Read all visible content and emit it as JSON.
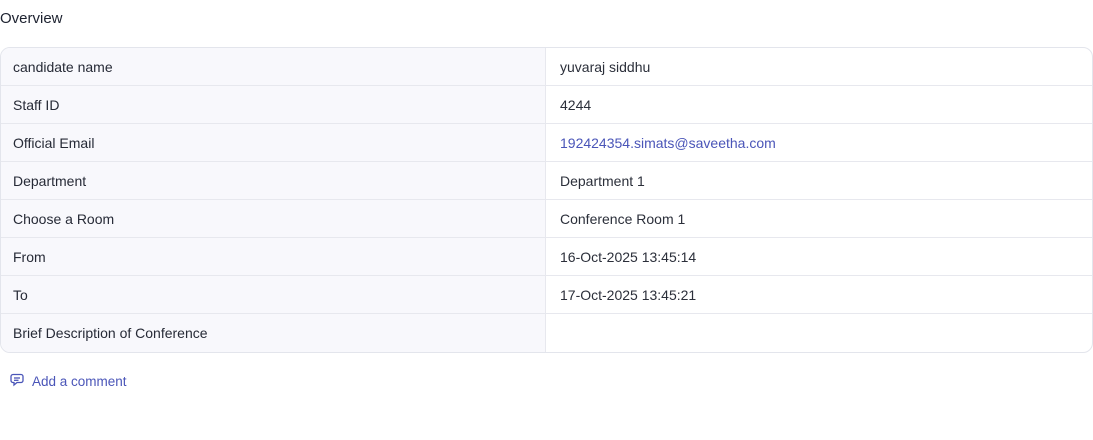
{
  "overview": {
    "title": "Overview",
    "rows": [
      {
        "label": "candidate name",
        "value": "yuvaraj siddhu"
      },
      {
        "label": "Staff ID",
        "value": "4244"
      },
      {
        "label": "Official Email",
        "value": "192424354.simats@saveetha.com"
      },
      {
        "label": "Department",
        "value": "Department 1"
      },
      {
        "label": "Choose a Room",
        "value": "Conference Room 1"
      },
      {
        "label": "From",
        "value": "16-Oct-2025 13:45:14"
      },
      {
        "label": "To",
        "value": "17-Oct-2025 13:45:21"
      },
      {
        "label": "Brief Description of Conference",
        "value": ""
      }
    ]
  },
  "comment": {
    "label": "Add a comment",
    "icon": "comment-icon"
  },
  "colors": {
    "accent": "#4a55b8",
    "label_bg": "#f8f8fc",
    "border": "#e3e5ec"
  }
}
